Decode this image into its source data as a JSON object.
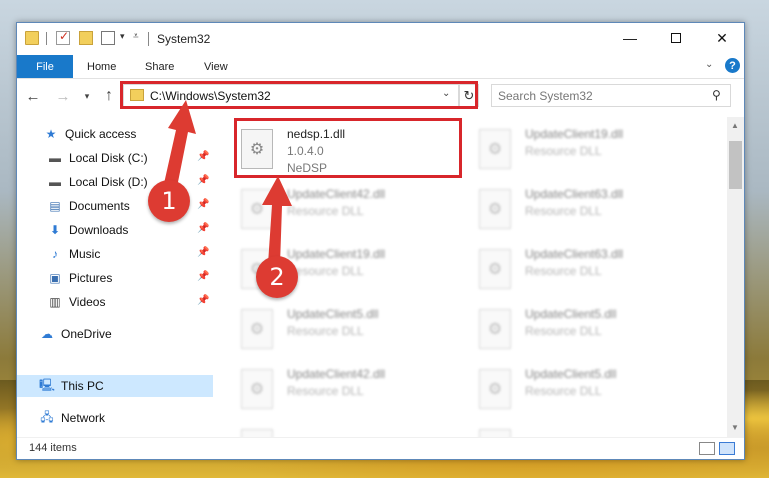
{
  "window": {
    "title": "System32",
    "controls": {
      "minimize": "—",
      "maximize": "",
      "close": "✕"
    }
  },
  "ribbon": {
    "tabs": [
      "File",
      "Home",
      "Share",
      "View"
    ],
    "expand_glyph": "⌄",
    "help_glyph": "?"
  },
  "address_bar": {
    "path": "C:\\Windows\\System32",
    "search_placeholder": "Search System32"
  },
  "nav_pane": {
    "items": [
      {
        "label": "Quick access",
        "icon": "star-icon"
      },
      {
        "label": "Local Disk (C:)",
        "icon": "drive-icon",
        "pinned": true
      },
      {
        "label": "Local Disk (D:)",
        "icon": "drive-icon",
        "pinned": true
      },
      {
        "label": "Documents",
        "icon": "documents-icon",
        "pinned": true
      },
      {
        "label": "Downloads",
        "icon": "download-icon",
        "pinned": true
      },
      {
        "label": "Music",
        "icon": "music-icon",
        "pinned": true
      },
      {
        "label": "Pictures",
        "icon": "pictures-icon",
        "pinned": true
      },
      {
        "label": "Videos",
        "icon": "videos-icon",
        "pinned": true
      },
      {
        "label": "OneDrive",
        "icon": "cloud-icon"
      },
      {
        "label": "This PC",
        "icon": "computer-icon",
        "selected": true
      },
      {
        "label": "Network",
        "icon": "network-icon"
      }
    ]
  },
  "content": {
    "highlighted_file": {
      "name": "nedsp.1.dll",
      "version": "1.0.4.0",
      "description": "NeDSP"
    },
    "blurred_files": [
      {
        "name": "UpdateClient19.dll",
        "sub": "Resource DLL"
      },
      {
        "name": "UpdateClient42.dll",
        "sub": "Resource DLL"
      },
      {
        "name": "UpdateClient63.dll",
        "sub": "Resource DLL"
      },
      {
        "name": "UpdateClient19.dll",
        "sub": "Resource DLL"
      },
      {
        "name": "UpdateClient63.dll",
        "sub": "Resource DLL"
      },
      {
        "name": "UpdateClient5.dll",
        "sub": "Resource DLL"
      },
      {
        "name": "UpdateClient5.dll",
        "sub": "Resource DLL"
      },
      {
        "name": "UpdateClient42.dll",
        "sub": "Resource DLL"
      },
      {
        "name": "UpdateClient5.dll",
        "sub": "Resource DLL"
      },
      {
        "name": "",
        "sub": ""
      },
      {
        "name": "",
        "sub": ""
      }
    ]
  },
  "status_bar": {
    "item_count": "144 items"
  },
  "annotations": {
    "step1": "1",
    "step2": "2",
    "color": "#dd3b32"
  },
  "colors": {
    "accent": "#1979ca",
    "highlight": "#d8262b",
    "selected_nav": "#cde8ff"
  }
}
